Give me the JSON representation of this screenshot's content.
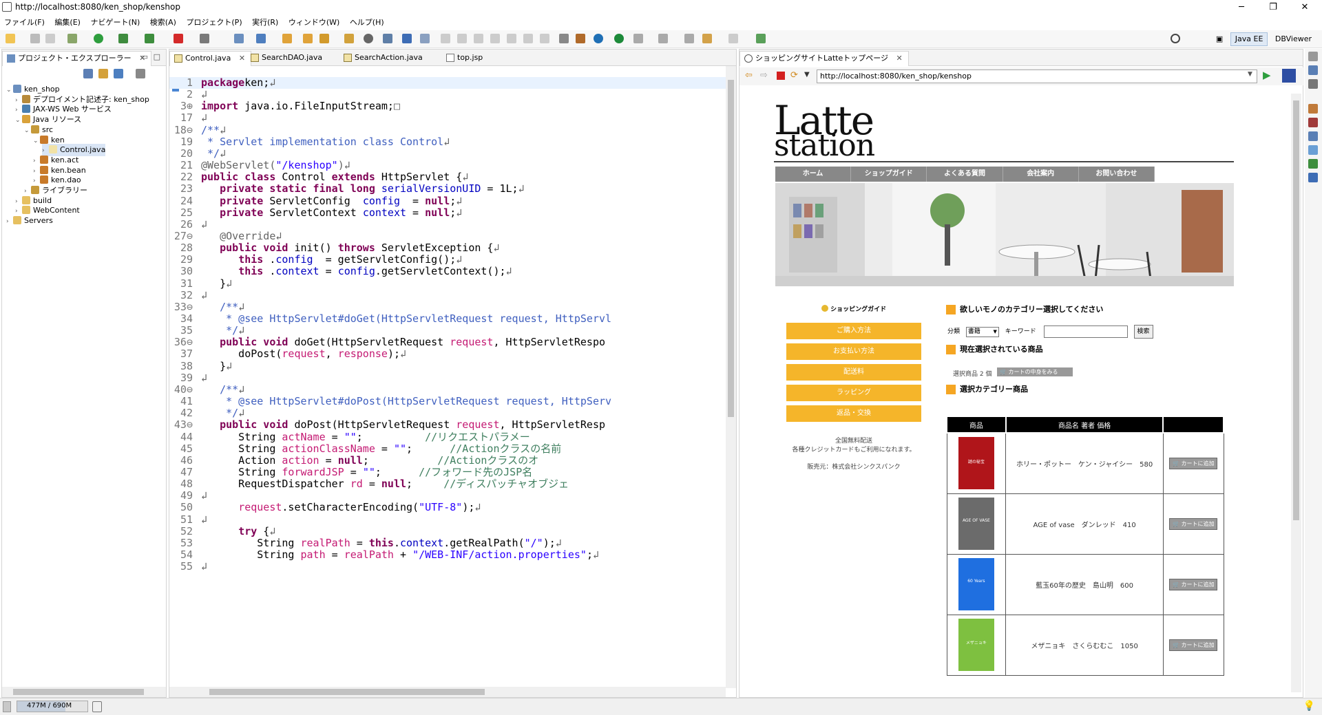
{
  "window": {
    "title": "http://localhost:8080/ken_shop/kenshop",
    "minimize": "─",
    "maximize": "❐",
    "close": "✕"
  },
  "menu": [
    "ファイル(F)",
    "編集(E)",
    "ナビゲート(N)",
    "検索(A)",
    "プロジェクト(P)",
    "実行(R)",
    "ウィンドウ(W)",
    "ヘルプ(H)"
  ],
  "perspectives": {
    "java_ee": "Java EE",
    "dbviewer": "DBViewer"
  },
  "explorer": {
    "title": "プロジェクト・エクスプローラー",
    "tree": [
      {
        "label": "ken_shop",
        "depth": 0,
        "twisty": "⌄",
        "icon": "project-icon"
      },
      {
        "label": "デプロイメント記述子: ken_shop",
        "depth": 1,
        "twisty": "›",
        "icon": "descriptor-icon"
      },
      {
        "label": "JAX-WS Web サービス",
        "depth": 1,
        "twisty": "›",
        "icon": "webservice-icon"
      },
      {
        "label": "Java リソース",
        "depth": 1,
        "twisty": "⌄",
        "icon": "java-resources-icon"
      },
      {
        "label": "src",
        "depth": 2,
        "twisty": "⌄",
        "icon": "source-folder-icon"
      },
      {
        "label": "ken",
        "depth": 3,
        "twisty": "⌄",
        "icon": "package-icon"
      },
      {
        "label": "Control.java",
        "depth": 4,
        "twisty": "›",
        "icon": "java-file-icon",
        "selected": true
      },
      {
        "label": "ken.act",
        "depth": 3,
        "twisty": "›",
        "icon": "package-icon"
      },
      {
        "label": "ken.bean",
        "depth": 3,
        "twisty": "›",
        "icon": "package-icon"
      },
      {
        "label": "ken.dao",
        "depth": 3,
        "twisty": "›",
        "icon": "package-icon"
      },
      {
        "label": "ライブラリー",
        "depth": 2,
        "twisty": "›",
        "icon": "library-icon"
      },
      {
        "label": "build",
        "depth": 1,
        "twisty": "›",
        "icon": "folder-icon"
      },
      {
        "label": "WebContent",
        "depth": 1,
        "twisty": "›",
        "icon": "folder-icon"
      },
      {
        "label": "Servers",
        "depth": 0,
        "twisty": "›",
        "icon": "folder-icon"
      }
    ]
  },
  "editor": {
    "tabs": [
      "Control.java",
      "SearchDAO.java",
      "SearchAction.java",
      "top.jsp"
    ],
    "lines": [
      {
        "n": "1",
        "segs": [
          [
            "kw",
            "package"
          ],
          [
            "",
            "ken;"
          ],
          [
            "an",
            "↲"
          ]
        ]
      },
      {
        "n": "2",
        "segs": [
          [
            "an",
            "↲"
          ]
        ]
      },
      {
        "n": "3⊕",
        "segs": [
          [
            "kw",
            "import"
          ],
          [
            "",
            " java.io.FileInputStream;"
          ],
          [
            "an",
            "□"
          ]
        ]
      },
      {
        "n": "17",
        "segs": [
          [
            "an",
            "↲"
          ]
        ]
      },
      {
        "n": "18⊖",
        "segs": [
          [
            "cm",
            "/**"
          ],
          [
            "an",
            "↲"
          ]
        ]
      },
      {
        "n": "19",
        "segs": [
          [
            "cm",
            " * Servlet implementation class Control"
          ],
          [
            "an",
            "↲"
          ]
        ]
      },
      {
        "n": "20",
        "segs": [
          [
            "cm",
            " */"
          ],
          [
            "an",
            "↲"
          ]
        ]
      },
      {
        "n": "21",
        "segs": [
          [
            "an",
            "@WebServlet("
          ],
          [
            "st",
            "\"/kenshop\""
          ],
          [
            "an",
            ")"
          ],
          [
            "an",
            "↲"
          ]
        ]
      },
      {
        "n": "22",
        "segs": [
          [
            "kw",
            "public class"
          ],
          [
            "",
            " Control "
          ],
          [
            "kw",
            "extends"
          ],
          [
            "",
            " HttpServlet {"
          ],
          [
            "an",
            "↲"
          ]
        ]
      },
      {
        "n": "23",
        "segs": [
          [
            "",
            "   "
          ],
          [
            "kw",
            "private static final long"
          ],
          [
            "",
            " "
          ],
          [
            "fd",
            "serialVersionUID"
          ],
          [
            "",
            " = 1L;"
          ],
          [
            "an",
            "↲"
          ]
        ]
      },
      {
        "n": "24",
        "segs": [
          [
            "",
            "   "
          ],
          [
            "kw",
            "private"
          ],
          [
            "",
            " ServletConfig  "
          ],
          [
            "fd",
            "config"
          ],
          [
            "",
            "  = "
          ],
          [
            "kw",
            "null"
          ],
          [
            ";"
          ],
          [
            "an",
            "↲"
          ]
        ]
      },
      {
        "n": "25",
        "segs": [
          [
            "",
            "   "
          ],
          [
            "kw",
            "private"
          ],
          [
            "",
            " ServletContext "
          ],
          [
            "fd",
            "context"
          ],
          [
            "",
            " = "
          ],
          [
            "kw",
            "null"
          ],
          [
            ";"
          ],
          [
            "an",
            "↲"
          ]
        ]
      },
      {
        "n": "26",
        "segs": [
          [
            "an",
            "↲"
          ]
        ]
      },
      {
        "n": "27⊖",
        "segs": [
          [
            "",
            "   "
          ],
          [
            "an",
            "@Override"
          ],
          [
            "an",
            "↲"
          ]
        ]
      },
      {
        "n": "28",
        "segs": [
          [
            "",
            "   "
          ],
          [
            "kw",
            "public void"
          ],
          [
            "",
            " init() "
          ],
          [
            "kw",
            "throws"
          ],
          [
            "",
            " ServletException {"
          ],
          [
            "an",
            "↲"
          ]
        ]
      },
      {
        "n": "29",
        "segs": [
          [
            "",
            "      "
          ],
          [
            "kw",
            "this"
          ],
          [
            "",
            " ."
          ],
          [
            "fd",
            "config"
          ],
          [
            "",
            "  = getServletConfig();"
          ],
          [
            "an",
            "↲"
          ]
        ]
      },
      {
        "n": "30",
        "segs": [
          [
            "",
            "      "
          ],
          [
            "kw",
            "this"
          ],
          [
            "",
            " ."
          ],
          [
            "fd",
            "context"
          ],
          [
            "",
            " = "
          ],
          [
            "fd",
            "config"
          ],
          [
            ".getServletContext();"
          ],
          [
            "an",
            "↲"
          ]
        ]
      },
      {
        "n": "31",
        "segs": [
          [
            "",
            "   }"
          ],
          [
            "an",
            "↲"
          ]
        ]
      },
      {
        "n": "32",
        "segs": [
          [
            "an",
            "↲"
          ]
        ]
      },
      {
        "n": "33⊖",
        "segs": [
          [
            "",
            "   "
          ],
          [
            "cm",
            "/**"
          ],
          [
            "an",
            "↲"
          ]
        ]
      },
      {
        "n": "34",
        "segs": [
          [
            "",
            "   "
          ],
          [
            "cm",
            " * @see HttpServlet#doGet(HttpServletRequest request, HttpServl"
          ]
        ]
      },
      {
        "n": "35",
        "segs": [
          [
            "",
            "   "
          ],
          [
            "cm",
            " */"
          ],
          [
            "an",
            "↲"
          ]
        ]
      },
      {
        "n": "36⊖",
        "segs": [
          [
            "",
            "   "
          ],
          [
            "kw",
            "public void"
          ],
          [
            "",
            " doGet(HttpServletRequest "
          ],
          [
            "lv",
            "request"
          ],
          [
            ", HttpServletRespo"
          ]
        ]
      },
      {
        "n": "37",
        "segs": [
          [
            "",
            "      doPost("
          ],
          [
            "lv",
            "request"
          ],
          [
            ", "
          ],
          [
            "lv",
            "response"
          ],
          [
            ");"
          ],
          [
            "an",
            "↲"
          ]
        ]
      },
      {
        "n": "38",
        "segs": [
          [
            "",
            "   }"
          ],
          [
            "an",
            "↲"
          ]
        ]
      },
      {
        "n": "39",
        "segs": [
          [
            "an",
            "↲"
          ]
        ]
      },
      {
        "n": "40⊖",
        "segs": [
          [
            "",
            "   "
          ],
          [
            "cm",
            "/**"
          ],
          [
            "an",
            "↲"
          ]
        ]
      },
      {
        "n": "41",
        "segs": [
          [
            "",
            "   "
          ],
          [
            "cm",
            " * @see HttpServlet#doPost(HttpServletRequest request, HttpServ"
          ]
        ]
      },
      {
        "n": "42",
        "segs": [
          [
            "",
            "   "
          ],
          [
            "cm",
            " */"
          ],
          [
            "an",
            "↲"
          ]
        ]
      },
      {
        "n": "43⊖",
        "segs": [
          [
            "",
            "   "
          ],
          [
            "kw",
            "public void"
          ],
          [
            "",
            " doPost(HttpServletRequest "
          ],
          [
            "lv",
            "request"
          ],
          [
            ", HttpServletResp"
          ]
        ]
      },
      {
        "n": "44",
        "segs": [
          [
            "",
            "      String "
          ],
          [
            "lv",
            "actName"
          ],
          [
            "",
            " = "
          ],
          [
            "st",
            "\"\""
          ],
          [
            ";          "
          ],
          [
            "sl",
            "//リクエストパラメー"
          ]
        ]
      },
      {
        "n": "45",
        "segs": [
          [
            "",
            "      String "
          ],
          [
            "lv",
            "actionClassName"
          ],
          [
            "",
            " = "
          ],
          [
            "st",
            "\"\""
          ],
          [
            ";      "
          ],
          [
            "sl",
            "//Actionクラスの名前"
          ]
        ]
      },
      {
        "n": "46",
        "segs": [
          [
            "",
            "      Action "
          ],
          [
            "lv",
            "action"
          ],
          [
            "",
            " = "
          ],
          [
            "kw",
            "null"
          ],
          [
            ";           "
          ],
          [
            "sl",
            "//Actionクラスのオ"
          ]
        ]
      },
      {
        "n": "47",
        "segs": [
          [
            "",
            "      String "
          ],
          [
            "lv",
            "forwardJSP"
          ],
          [
            "",
            " = "
          ],
          [
            "st",
            "\"\""
          ],
          [
            ";      "
          ],
          [
            "sl",
            "//フォワード先のJSP名"
          ]
        ]
      },
      {
        "n": "48",
        "segs": [
          [
            "",
            "      RequestDispatcher "
          ],
          [
            "lv",
            "rd"
          ],
          [
            "",
            " = "
          ],
          [
            "kw",
            "null"
          ],
          [
            ";     "
          ],
          [
            "sl",
            "//ディスパッチャオブジェ"
          ]
        ]
      },
      {
        "n": "49",
        "segs": [
          [
            "an",
            "↲"
          ]
        ]
      },
      {
        "n": "50",
        "segs": [
          [
            "",
            "      "
          ],
          [
            "lv",
            "request"
          ],
          [
            ".setCharacterEncoding("
          ],
          [
            "st",
            "\"UTF-8\""
          ],
          [
            ");"
          ],
          [
            "an",
            "↲"
          ]
        ]
      },
      {
        "n": "51",
        "segs": [
          [
            "an",
            "↲"
          ]
        ]
      },
      {
        "n": "52",
        "segs": [
          [
            "",
            "      "
          ],
          [
            "kw",
            "try"
          ],
          [
            " {"
          ],
          [
            "an",
            "↲"
          ]
        ]
      },
      {
        "n": "53",
        "segs": [
          [
            "",
            "         String "
          ],
          [
            "lv",
            "realPath"
          ],
          [
            "",
            " = "
          ],
          [
            "kw",
            "this"
          ],
          [
            "."
          ],
          [
            "fd",
            "context"
          ],
          [
            ".getRealPath("
          ],
          [
            "st",
            "\"/\""
          ],
          [
            ");"
          ],
          [
            "an",
            "↲"
          ]
        ]
      },
      {
        "n": "54",
        "segs": [
          [
            "",
            "         String "
          ],
          [
            "lv",
            "path"
          ],
          [
            "",
            " = "
          ],
          [
            "lv",
            "realPath"
          ],
          [
            " + "
          ],
          [
            "st",
            "\"/WEB-INF/action.properties\""
          ],
          [
            ";"
          ],
          [
            "an",
            "↲"
          ]
        ]
      },
      {
        "n": "55",
        "segs": [
          [
            "an",
            "↲"
          ]
        ]
      }
    ]
  },
  "browser": {
    "tab": "ショッピングサイトLatteトップページ",
    "url": "http://localhost:8080/ken_shop/kenshop",
    "site": {
      "logo_line1": "Latte",
      "logo_line2": "station",
      "nav": [
        "ホーム",
        "ショップガイド",
        "よくある質問",
        "会社案内",
        "お問い合わせ"
      ],
      "guide_heading": "ショッピングガイド",
      "guide_buttons": [
        "ご購入方法",
        "お支払い方法",
        "配送料",
        "ラッピング",
        "返品・交換"
      ],
      "free_shipping": "全国無料配送",
      "cards": "各種クレジットカードもご利用になれます。",
      "seller": "販売元：株式会社シンクスパンク",
      "category_heading": "欲しいモノのカテゴリー選択してください",
      "bunrui_label": "分類",
      "bunrui_value": "書籍",
      "keyword_label": "キーワード",
      "keyword_value": "",
      "search_button": "検索",
      "selected_heading": "現在選択されている商品",
      "selected_count": "選択商品 2 個",
      "cart_view_button": "カートの中身をみる",
      "category_products_heading": "選択カテゴリー商品",
      "table_headers": [
        "商品",
        "商品名 著者 価格",
        ""
      ],
      "products": [
        {
          "name": "ホリー・ポットー",
          "author": "ケン・ジャイシー",
          "price": "580",
          "cover": "#b0151a",
          "cover_text": "謎の秘宝"
        },
        {
          "name": "AGE of vase",
          "author": "ダンレッド",
          "price": "410",
          "cover": "#6b6b6b",
          "cover_text": "AGE OF VASE"
        },
        {
          "name": "藍玉60年の歴史",
          "author": "島山明",
          "price": "600",
          "cover": "#1f6fe0",
          "cover_text": "60 Years"
        },
        {
          "name": "メザニョキ",
          "author": "さくらむむこ",
          "price": "1050",
          "cover": "#7ec040",
          "cover_text": "メザニョキ"
        }
      ],
      "add_to_cart": "カートに追加"
    }
  },
  "status": {
    "memory": "477M / 690M"
  }
}
